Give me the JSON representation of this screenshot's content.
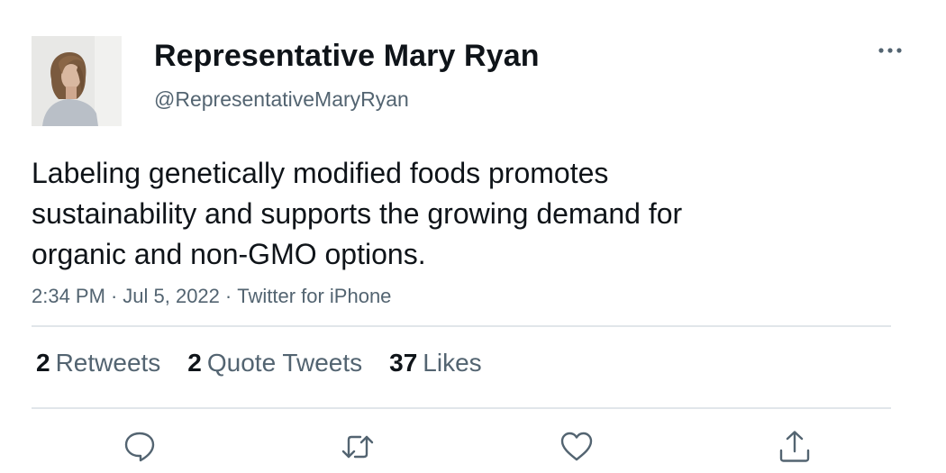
{
  "author": {
    "display_name": "Representative Mary Ryan",
    "handle": "@RepresentativeMaryRyan",
    "avatar_icon": "profile-photo"
  },
  "tweet": {
    "text_lines": [
      "Labeling genetically modified foods promotes",
      "sustainability and supports the growing demand for",
      "organic and non-GMO options."
    ],
    "time": "2:34 PM",
    "date": "Jul 5, 2022",
    "source": "Twitter for iPhone",
    "separator": "·"
  },
  "stats": {
    "retweets": {
      "count": "2",
      "label": "Retweets"
    },
    "quote_tweets": {
      "count": "2",
      "label": "Quote Tweets"
    },
    "likes": {
      "count": "37",
      "label": "Likes"
    }
  },
  "actions": [
    "reply-icon",
    "retweet-icon",
    "like-icon",
    "share-icon"
  ],
  "colors": {
    "text_primary": "#0f1419",
    "text_secondary": "#536471",
    "divider": "#e1e6ea"
  }
}
